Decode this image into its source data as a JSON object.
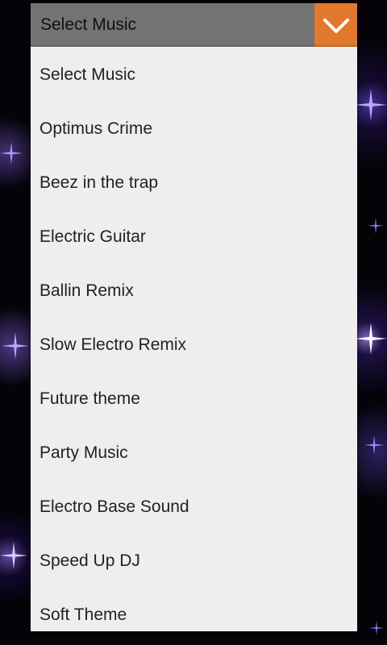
{
  "dropdown": {
    "selected_label": "Select Music",
    "toggle_icon": "chevron-down-icon",
    "accent_color": "#e1782e"
  },
  "options": [
    "Select Music",
    "Optimus Crime",
    "Beez in the trap",
    "Electric Guitar",
    "Ballin Remix",
    "Slow Electro Remix",
    "Future theme",
    "Party Music",
    "Electro Base Sound",
    "Speed Up DJ",
    "Soft Theme"
  ]
}
